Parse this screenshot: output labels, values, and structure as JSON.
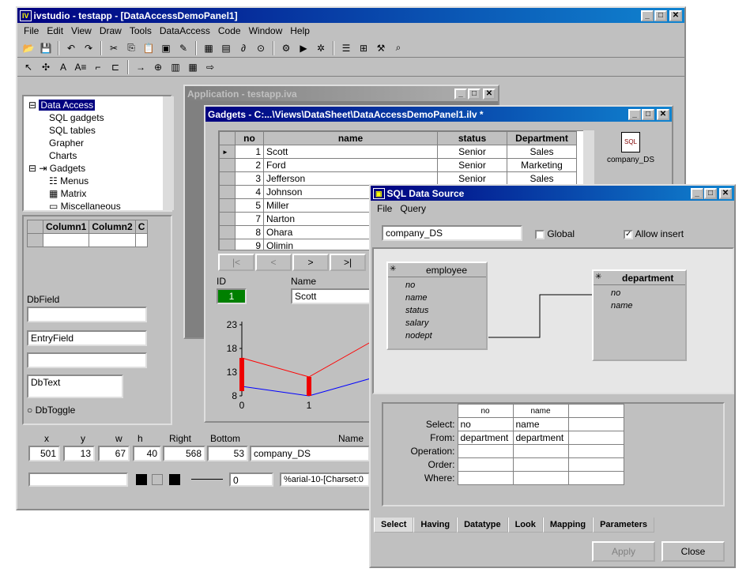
{
  "main": {
    "title": "ivstudio - testapp - [DataAccessDemoPanel1]",
    "logo": "IV",
    "menu": [
      "File",
      "Edit",
      "View",
      "Draw",
      "Tools",
      "DataAccess",
      "Code",
      "Window",
      "Help"
    ]
  },
  "tree": {
    "items": [
      "Data Access",
      "SQL gadgets",
      "SQL tables",
      "Grapher",
      "Charts",
      "Gadgets",
      "Menus",
      "Matrix",
      "Miscellaneous"
    ]
  },
  "palette": {
    "col1": "Column1",
    "col2": "Column2",
    "col3": "C",
    "dbfield_label": "DbField",
    "entry_field": "EntryField",
    "dbtext": "DbText",
    "dbtoggle": "DbToggle"
  },
  "props": {
    "headers": [
      "x",
      "y",
      "w",
      "h",
      "Right",
      "Bottom",
      "Name"
    ],
    "values": [
      "501",
      "13",
      "67",
      "40",
      "568",
      "53",
      "company_DS"
    ],
    "font": "%arial-10-[Charset:0",
    "line_width": "0"
  },
  "appwin": {
    "title": "Application - testapp.iva"
  },
  "gadgets": {
    "title": "Gadgets - C:...\\Views\\DataSheet\\DataAccessDemoPanel1.ilv *",
    "columns": [
      "no",
      "name",
      "status",
      "Department"
    ],
    "rows": [
      [
        "1",
        "Scott",
        "Senior",
        "Sales"
      ],
      [
        "2",
        "Ford",
        "Senior",
        "Marketing"
      ],
      [
        "3",
        "Jefferson",
        "Senior",
        "Sales"
      ],
      [
        "4",
        "Johnson",
        "",
        ""
      ],
      [
        "5",
        "Miller",
        "",
        ""
      ],
      [
        "7",
        "Narton",
        "",
        ""
      ],
      [
        "8",
        "Ohara",
        "",
        ""
      ],
      [
        "9",
        "Olimin",
        "",
        ""
      ]
    ],
    "nav": [
      "|<",
      "<",
      ">",
      ">|"
    ],
    "id_label": "ID",
    "name_label": "Name",
    "id_value": "1",
    "name_value": "Scott",
    "ds_label": "company_DS",
    "sql_icon": "SQL"
  },
  "chart_data": {
    "type": "line",
    "x": [
      0,
      1,
      2
    ],
    "ylim": [
      8,
      23
    ],
    "yticks": [
      "23",
      "18",
      "13",
      "8"
    ],
    "xticks": [
      "0",
      "1"
    ],
    "series": [
      {
        "values": [
          16,
          12,
          20
        ],
        "color": "#ff0000"
      },
      {
        "values": [
          10,
          8,
          12
        ],
        "color": "#0000ff"
      }
    ],
    "bars": [
      {
        "x": 0,
        "low": 9,
        "high": 16
      },
      {
        "x": 1,
        "low": 8,
        "high": 12
      }
    ]
  },
  "sql": {
    "title": "SQL Data Source",
    "menu": [
      "File",
      "Query"
    ],
    "ds_name": "company_DS",
    "global": "Global",
    "allow_insert": "Allow insert",
    "employee": {
      "name": "employee",
      "fields": [
        "no",
        "name",
        "status",
        "salary",
        "nodept"
      ]
    },
    "department": {
      "name": "department",
      "fields": [
        "no",
        "name"
      ]
    },
    "grid_headers": [
      "no",
      "name"
    ],
    "row_labels": [
      "Select:",
      "From:",
      "Operation:",
      "Order:",
      "Where:"
    ],
    "grid_rows": [
      [
        "no",
        "name"
      ],
      [
        "department",
        "department"
      ],
      [
        "",
        ""
      ],
      [
        "",
        ""
      ],
      [
        "",
        ""
      ]
    ],
    "tabs": [
      "Select",
      "Having",
      "Datatype",
      "Look",
      "Mapping",
      "Parameters"
    ],
    "apply": "Apply",
    "close": "Close"
  }
}
